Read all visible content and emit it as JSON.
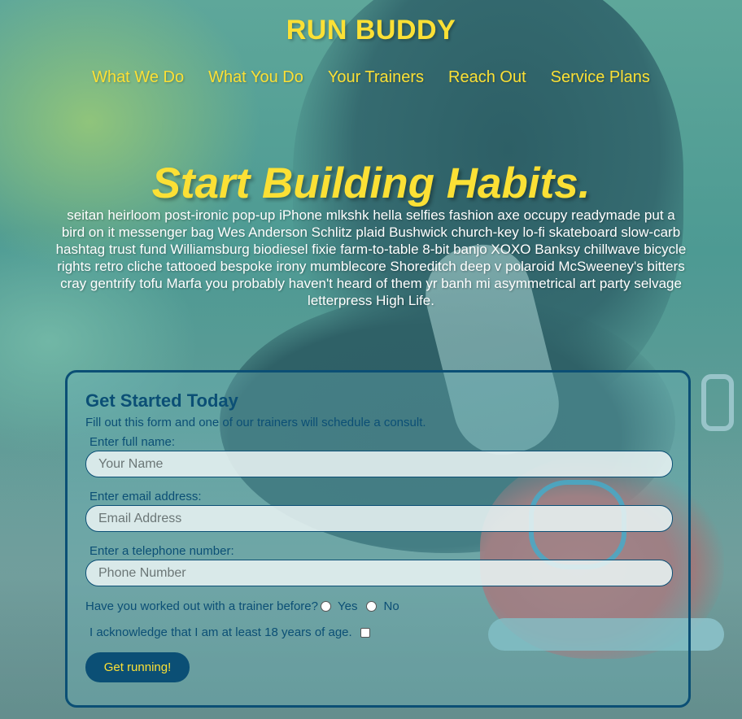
{
  "header": {
    "logo": "RUN BUDDY",
    "nav": [
      "What We Do",
      "What You Do",
      "Your Trainers",
      "Reach Out",
      "Service Plans"
    ]
  },
  "hero": {
    "title": "Start Building Habits.",
    "body": "seitan heirloom post-ironic pop-up iPhone mlkshk hella selfies fashion axe occupy readymade put a bird on it messenger bag Wes Anderson Schlitz plaid Bushwick church-key lo-fi skateboard slow-carb hashtag trust fund Williamsburg biodiesel fixie farm-to-table 8-bit banjo XOXO Banksy chillwave bicycle rights retro cliche tattooed bespoke irony mumblecore Shoreditch deep v polaroid McSweeney's bitters cray gentrify tofu Marfa you probably haven't heard of them yr banh mi asymmetrical art party selvage letterpress High Life."
  },
  "form": {
    "title": "Get Started Today",
    "subtitle": "Fill out this form and one of our trainers will schedule a consult.",
    "name_label": "Enter full name:",
    "name_placeholder": "Your Name",
    "email_label": "Enter email address:",
    "email_placeholder": "Email Address",
    "phone_label": "Enter a telephone number:",
    "phone_placeholder": "Phone Number",
    "trainer_question": "Have you worked out with a trainer before?",
    "yes_label": "Yes",
    "no_label": "No",
    "age_ack": "I acknowledge that I am at least 18 years of age.",
    "submit_label": "Get running!"
  },
  "colors": {
    "accent_yellow": "#fbe035",
    "primary_blue": "#0b4f75"
  }
}
